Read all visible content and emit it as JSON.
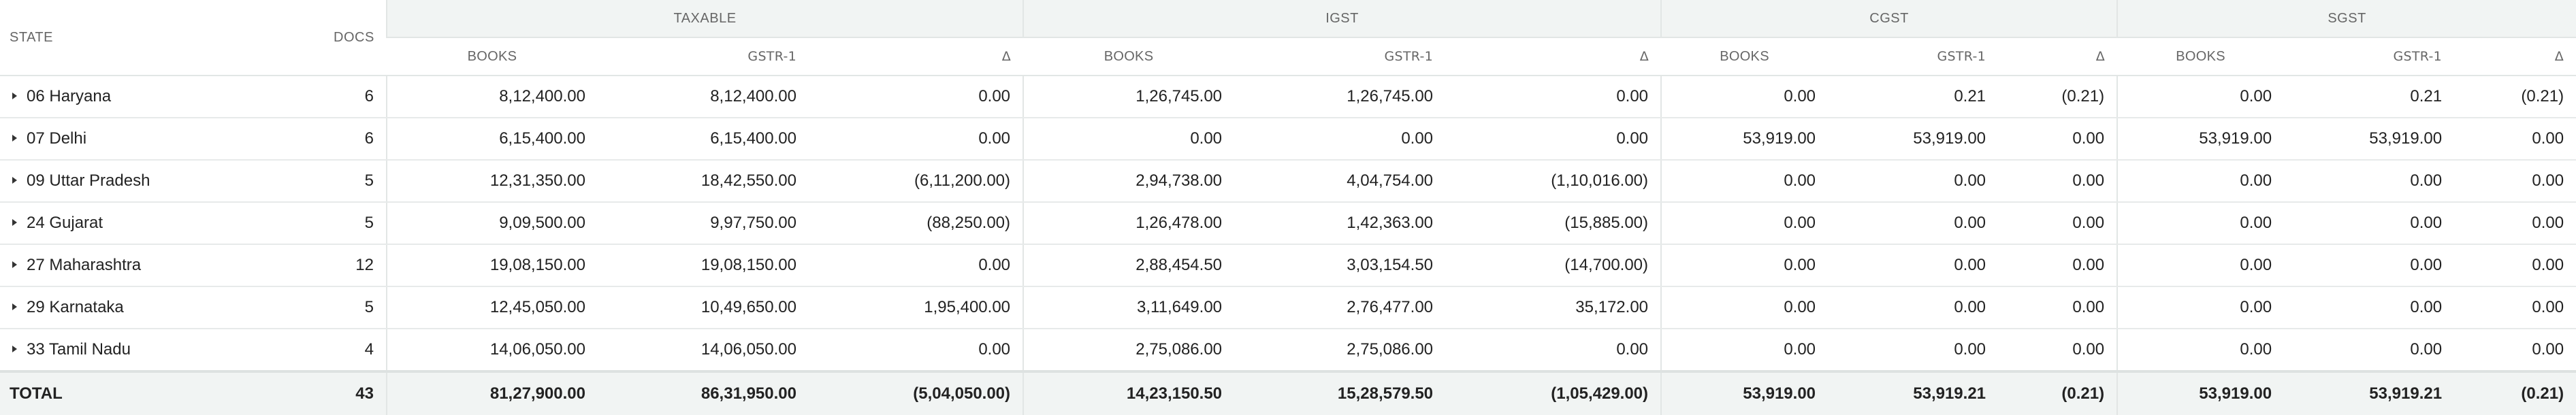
{
  "header": {
    "state_label": "STATE",
    "docs_label": "DOCS",
    "groups": [
      {
        "label": "TAXABLE"
      },
      {
        "label": "IGST"
      },
      {
        "label": "CGST"
      },
      {
        "label": "SGST"
      }
    ],
    "sub": {
      "books": "BOOKS",
      "gstr1": "GSTR-1",
      "delta": "Δ"
    }
  },
  "rows": [
    {
      "state": "06 Haryana",
      "docs": "6",
      "vals": [
        "8,12,400.00",
        "8,12,400.00",
        "0.00",
        "1,26,745.00",
        "1,26,745.00",
        "0.00",
        "0.00",
        "0.21",
        "(0.21)",
        "0.00",
        "0.21",
        "(0.21)"
      ]
    },
    {
      "state": "07 Delhi",
      "docs": "6",
      "vals": [
        "6,15,400.00",
        "6,15,400.00",
        "0.00",
        "0.00",
        "0.00",
        "0.00",
        "53,919.00",
        "53,919.00",
        "0.00",
        "53,919.00",
        "53,919.00",
        "0.00"
      ]
    },
    {
      "state": "09 Uttar Pradesh",
      "docs": "5",
      "vals": [
        "12,31,350.00",
        "18,42,550.00",
        "(6,11,200.00)",
        "2,94,738.00",
        "4,04,754.00",
        "(1,10,016.00)",
        "0.00",
        "0.00",
        "0.00",
        "0.00",
        "0.00",
        "0.00"
      ]
    },
    {
      "state": "24 Gujarat",
      "docs": "5",
      "vals": [
        "9,09,500.00",
        "9,97,750.00",
        "(88,250.00)",
        "1,26,478.00",
        "1,42,363.00",
        "(15,885.00)",
        "0.00",
        "0.00",
        "0.00",
        "0.00",
        "0.00",
        "0.00"
      ]
    },
    {
      "state": "27 Maharashtra",
      "docs": "12",
      "vals": [
        "19,08,150.00",
        "19,08,150.00",
        "0.00",
        "2,88,454.50",
        "3,03,154.50",
        "(14,700.00)",
        "0.00",
        "0.00",
        "0.00",
        "0.00",
        "0.00",
        "0.00"
      ]
    },
    {
      "state": "29 Karnataka",
      "docs": "5",
      "vals": [
        "12,45,050.00",
        "10,49,650.00",
        "1,95,400.00",
        "3,11,649.00",
        "2,76,477.00",
        "35,172.00",
        "0.00",
        "0.00",
        "0.00",
        "0.00",
        "0.00",
        "0.00"
      ]
    },
    {
      "state": "33 Tamil Nadu",
      "docs": "4",
      "vals": [
        "14,06,050.00",
        "14,06,050.00",
        "0.00",
        "2,75,086.00",
        "2,75,086.00",
        "0.00",
        "0.00",
        "0.00",
        "0.00",
        "0.00",
        "0.00",
        "0.00"
      ]
    }
  ],
  "total": {
    "label": "TOTAL",
    "docs": "43",
    "vals": [
      "81,27,900.00",
      "86,31,950.00",
      "(5,04,050.00)",
      "14,23,150.50",
      "15,28,579.50",
      "(1,05,429.00)",
      "53,919.00",
      "53,919.21",
      "(0.21)",
      "53,919.00",
      "53,919.21",
      "(0.21)"
    ]
  }
}
